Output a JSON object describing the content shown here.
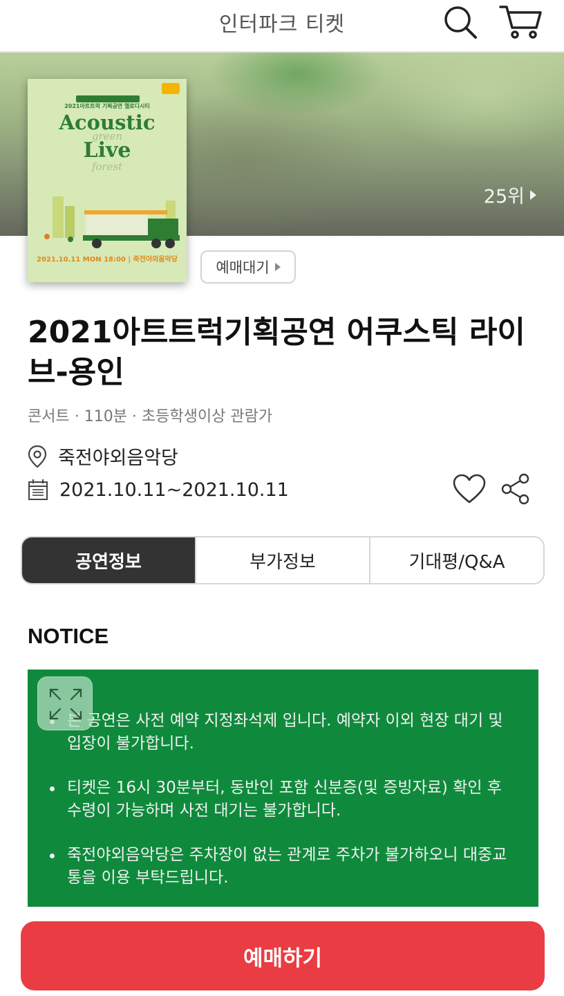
{
  "header": {
    "title": "인터파크 티켓"
  },
  "banner": {
    "rank": "25위"
  },
  "poster": {
    "subtitle": "2021아트트럭 기획공연 멜로디시티",
    "line1": "Acoustic",
    "line2": "green",
    "line3": "Live",
    "line4": "forest",
    "date_line": "2021.10.11 MON 18:00 | 죽전야외음악당"
  },
  "status_button": {
    "label": "예매대기"
  },
  "show": {
    "title": "2021아트트럭기획공연 어쿠스틱 라이브-용인",
    "meta": "콘서트 · 110분 · 초등학생이상 관람가",
    "venue": "죽전야외음악당",
    "period": "2021.10.11~2021.10.11"
  },
  "tabs": [
    {
      "label": "공연정보",
      "active": true
    },
    {
      "label": "부가정보",
      "active": false
    },
    {
      "label": "기대평/Q&A",
      "active": false
    }
  ],
  "notice": {
    "heading": "NOTICE",
    "items": [
      "본 공연은 사전 예약 지정좌석제 입니다. 예약자 이외 현장 대기 및 입장이 불가합니다.",
      "티켓은 16시 30분부터, 동반인 포함 신분증(및 증빙자료) 확인 후 수령이 가능하며 사전 대기는 불가합니다.",
      "죽전야외음악당은 주차장이 없는 관계로 주차가 불가하오니 대중교통을 이용 부탁드립니다."
    ]
  },
  "book_button": {
    "label": "예매하기"
  },
  "colors": {
    "accent_red": "#ea3d43",
    "notice_green": "#0f8a3c",
    "tab_active": "#333333"
  }
}
